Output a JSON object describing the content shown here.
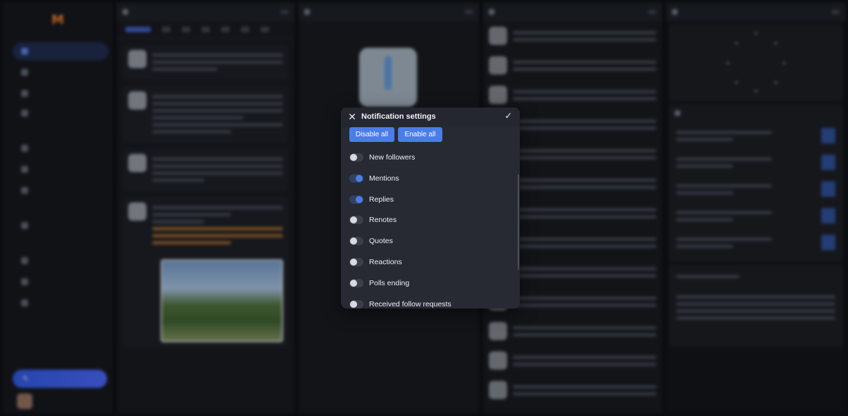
{
  "modal": {
    "title": "Notification settings",
    "close_icon": "close-icon",
    "confirm_icon": "check-icon",
    "disable_all": "Disable all",
    "enable_all": "Enable all",
    "options": [
      {
        "label": "New followers",
        "on": false
      },
      {
        "label": "Mentions",
        "on": true
      },
      {
        "label": "Replies",
        "on": true
      },
      {
        "label": "Renotes",
        "on": false
      },
      {
        "label": "Quotes",
        "on": false
      },
      {
        "label": "Reactions",
        "on": false
      },
      {
        "label": "Polls ending",
        "on": false
      },
      {
        "label": "Received follow requests",
        "on": false
      }
    ]
  },
  "colors": {
    "accent": "#4a7de8",
    "modal_bg": "#272a33",
    "app_bg": "#0e1014"
  }
}
